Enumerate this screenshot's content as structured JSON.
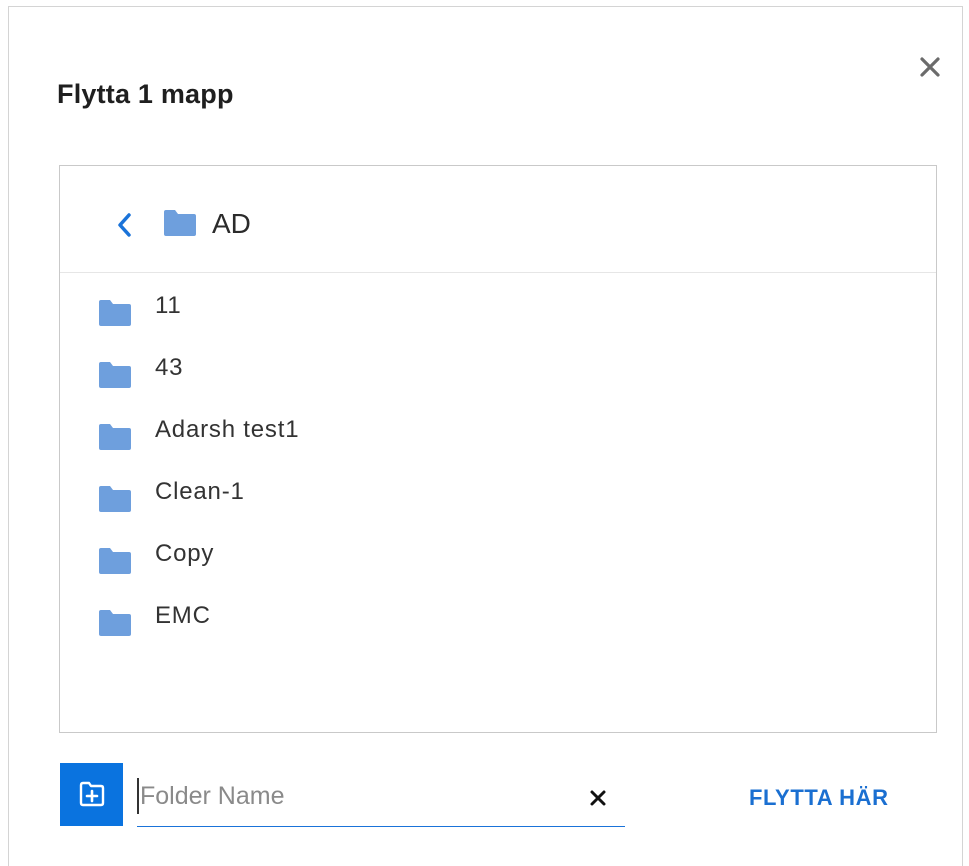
{
  "dialog": {
    "title": "Flytta 1 mapp",
    "close_icon": "close-icon"
  },
  "browser": {
    "current_folder": "AD",
    "back_icon": "chevron-left-icon",
    "folder_icon": "folder-icon",
    "folder_color": "#6e9fdd",
    "items": [
      {
        "label": "11"
      },
      {
        "label": "43"
      },
      {
        "label": "Adarsh test1"
      },
      {
        "label": "Clean-1"
      },
      {
        "label": "Copy"
      },
      {
        "label": "EMC"
      }
    ]
  },
  "footer": {
    "new_folder_icon": "new-folder-icon",
    "new_folder_button_color": "#0a73df",
    "folder_name_placeholder": "Folder Name",
    "folder_name_value": "",
    "clear_icon": "clear-icon",
    "move_here_label": "FLYTTA HÄR",
    "accent_color": "#1a6fd1"
  }
}
